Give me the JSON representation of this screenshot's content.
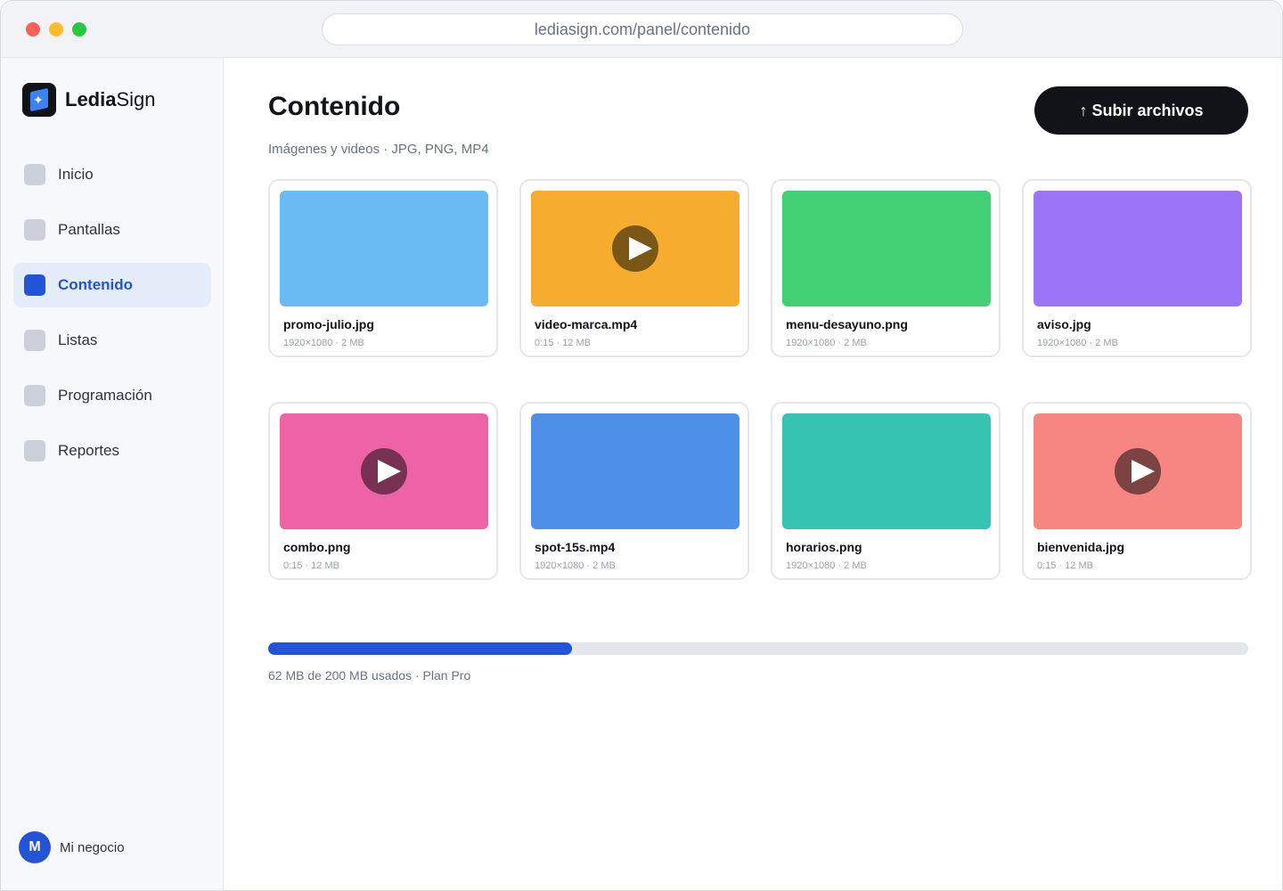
{
  "browser": {
    "url": "lediasign.com/panel/contenido"
  },
  "brand": {
    "name_bold": "Ledia",
    "name_regular": "Sign",
    "icon": "logo-icon"
  },
  "sidebar": {
    "items": [
      {
        "label": "Inicio",
        "active": false
      },
      {
        "label": "Pantallas",
        "active": false
      },
      {
        "label": "Contenido",
        "active": true
      },
      {
        "label": "Listas",
        "active": false
      },
      {
        "label": "Programación",
        "active": false
      },
      {
        "label": "Reportes",
        "active": false
      }
    ],
    "account": {
      "initial": "M",
      "name": "Mi negocio"
    }
  },
  "header": {
    "title": "Contenido",
    "subtitle": "Imágenes y videos · JPG, PNG, MP4",
    "upload_label": "↑ Subir archivos"
  },
  "files": [
    {
      "name": "promo-julio.jpg",
      "meta": "1920×1080 · 2 MB",
      "color": "#6abbf3",
      "play": false
    },
    {
      "name": "video-marca.mp4",
      "meta": "0:15 · 12 MB",
      "color": "#f5ac2f",
      "play": true
    },
    {
      "name": "menu-desayuno.png",
      "meta": "1920×1080 · 2 MB",
      "color": "#43cf73",
      "play": false
    },
    {
      "name": "aviso.jpg",
      "meta": "1920×1080 · 2 MB",
      "color": "#9b75f5",
      "play": false
    },
    {
      "name": "combo.png",
      "meta": "0:15 · 12 MB",
      "color": "#ee62a6",
      "play": true
    },
    {
      "name": "spot-15s.mp4",
      "meta": "1920×1080 · 2 MB",
      "color": "#4e8fe8",
      "play": false
    },
    {
      "name": "horarios.png",
      "meta": "1920×1080 · 2 MB",
      "color": "#37c3b2",
      "play": false
    },
    {
      "name": "bienvenida.jpg",
      "meta": "0:15 · 12 MB",
      "color": "#f78683",
      "play": true
    }
  ],
  "storage": {
    "used_fraction": 0.31,
    "label": "62 MB de 200 MB usados · Plan Pro"
  }
}
